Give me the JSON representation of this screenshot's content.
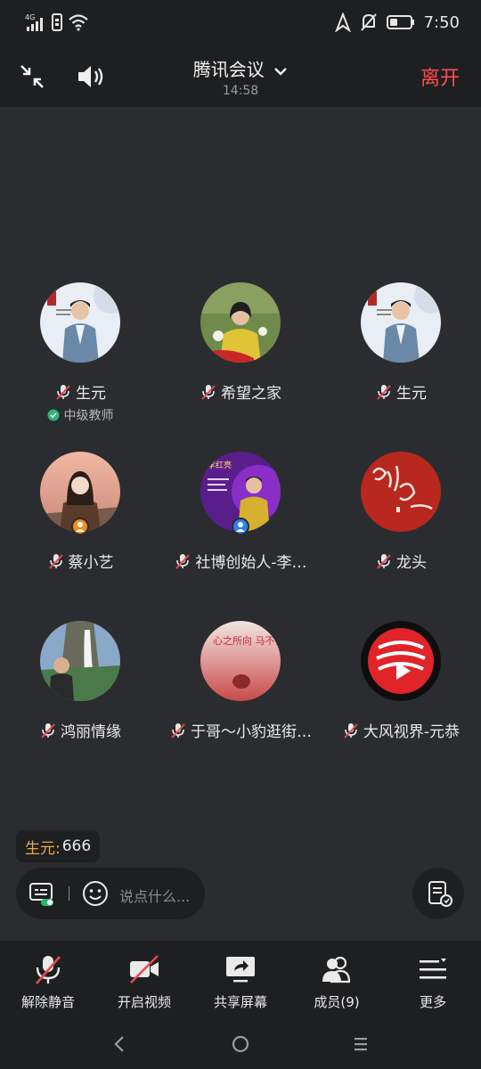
{
  "status_bar": {
    "network": "4G",
    "time": "7:50"
  },
  "header": {
    "title": "腾讯会议",
    "duration": "14:58",
    "leave_label": "离开"
  },
  "participants": [
    {
      "name": "生元",
      "subtitle": "中级教师",
      "muted": true
    },
    {
      "name": "希望之家",
      "muted": true
    },
    {
      "name": "生元",
      "muted": true
    },
    {
      "name": "蔡小艺",
      "muted": true
    },
    {
      "name": "社博创始人-李…",
      "muted": true
    },
    {
      "name": "龙头",
      "muted": true
    },
    {
      "name": "鸿丽情缘",
      "muted": true
    },
    {
      "name": "于哥～小豹逛街…",
      "muted": true
    },
    {
      "name": "大风视界-元恭",
      "muted": true
    }
  ],
  "avatar_text": {
    "li_banner": "李红亮",
    "calligraphy": "心之所向 马不停蹄"
  },
  "chat": {
    "author": "生元:",
    "message": "666"
  },
  "input": {
    "placeholder": "说点什么..."
  },
  "toolbar": [
    {
      "label": "解除静音",
      "icon": "mic-off-icon"
    },
    {
      "label": "开启视频",
      "icon": "video-off-icon"
    },
    {
      "label": "共享屏幕",
      "icon": "share-screen-icon"
    },
    {
      "label": "成员(9)",
      "icon": "members-icon"
    },
    {
      "label": "更多",
      "icon": "more-icon"
    }
  ],
  "colors": {
    "accent_leave": "#ff4d4f",
    "chat_author": "#f0a54a",
    "mute_red": "#e84a4a"
  }
}
